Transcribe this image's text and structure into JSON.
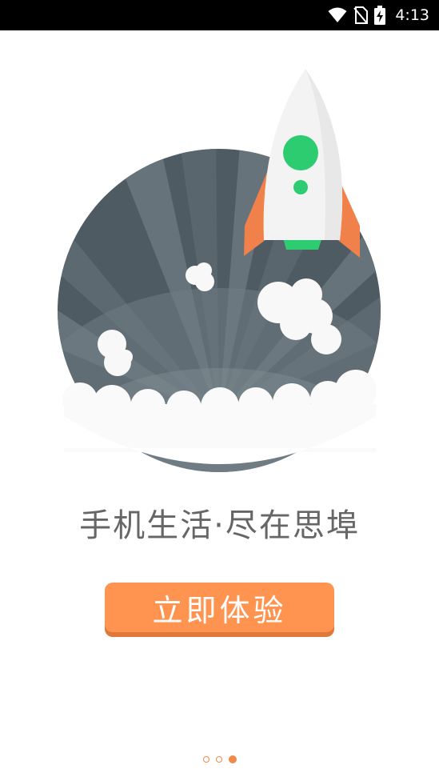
{
  "status_bar": {
    "time": "4:13",
    "icons": [
      "wifi-icon",
      "no-sim-icon",
      "battery-charging-icon"
    ]
  },
  "illustration": {
    "subject": "rocket-launch-icon",
    "colors": {
      "circle_dark": "#4f5b62",
      "circle_light": "#6f7c84",
      "rocket_body": "#f3f3f3",
      "rocket_accent": "#2ecc71",
      "rocket_fins": "#f0814a",
      "cloud": "#fafafa"
    }
  },
  "main": {
    "slogan": "手机生活·尽在思埠",
    "cta_label": "立即体验"
  },
  "pager": {
    "total": 3,
    "active_index": 2,
    "accent_color": "#f08a4b"
  }
}
